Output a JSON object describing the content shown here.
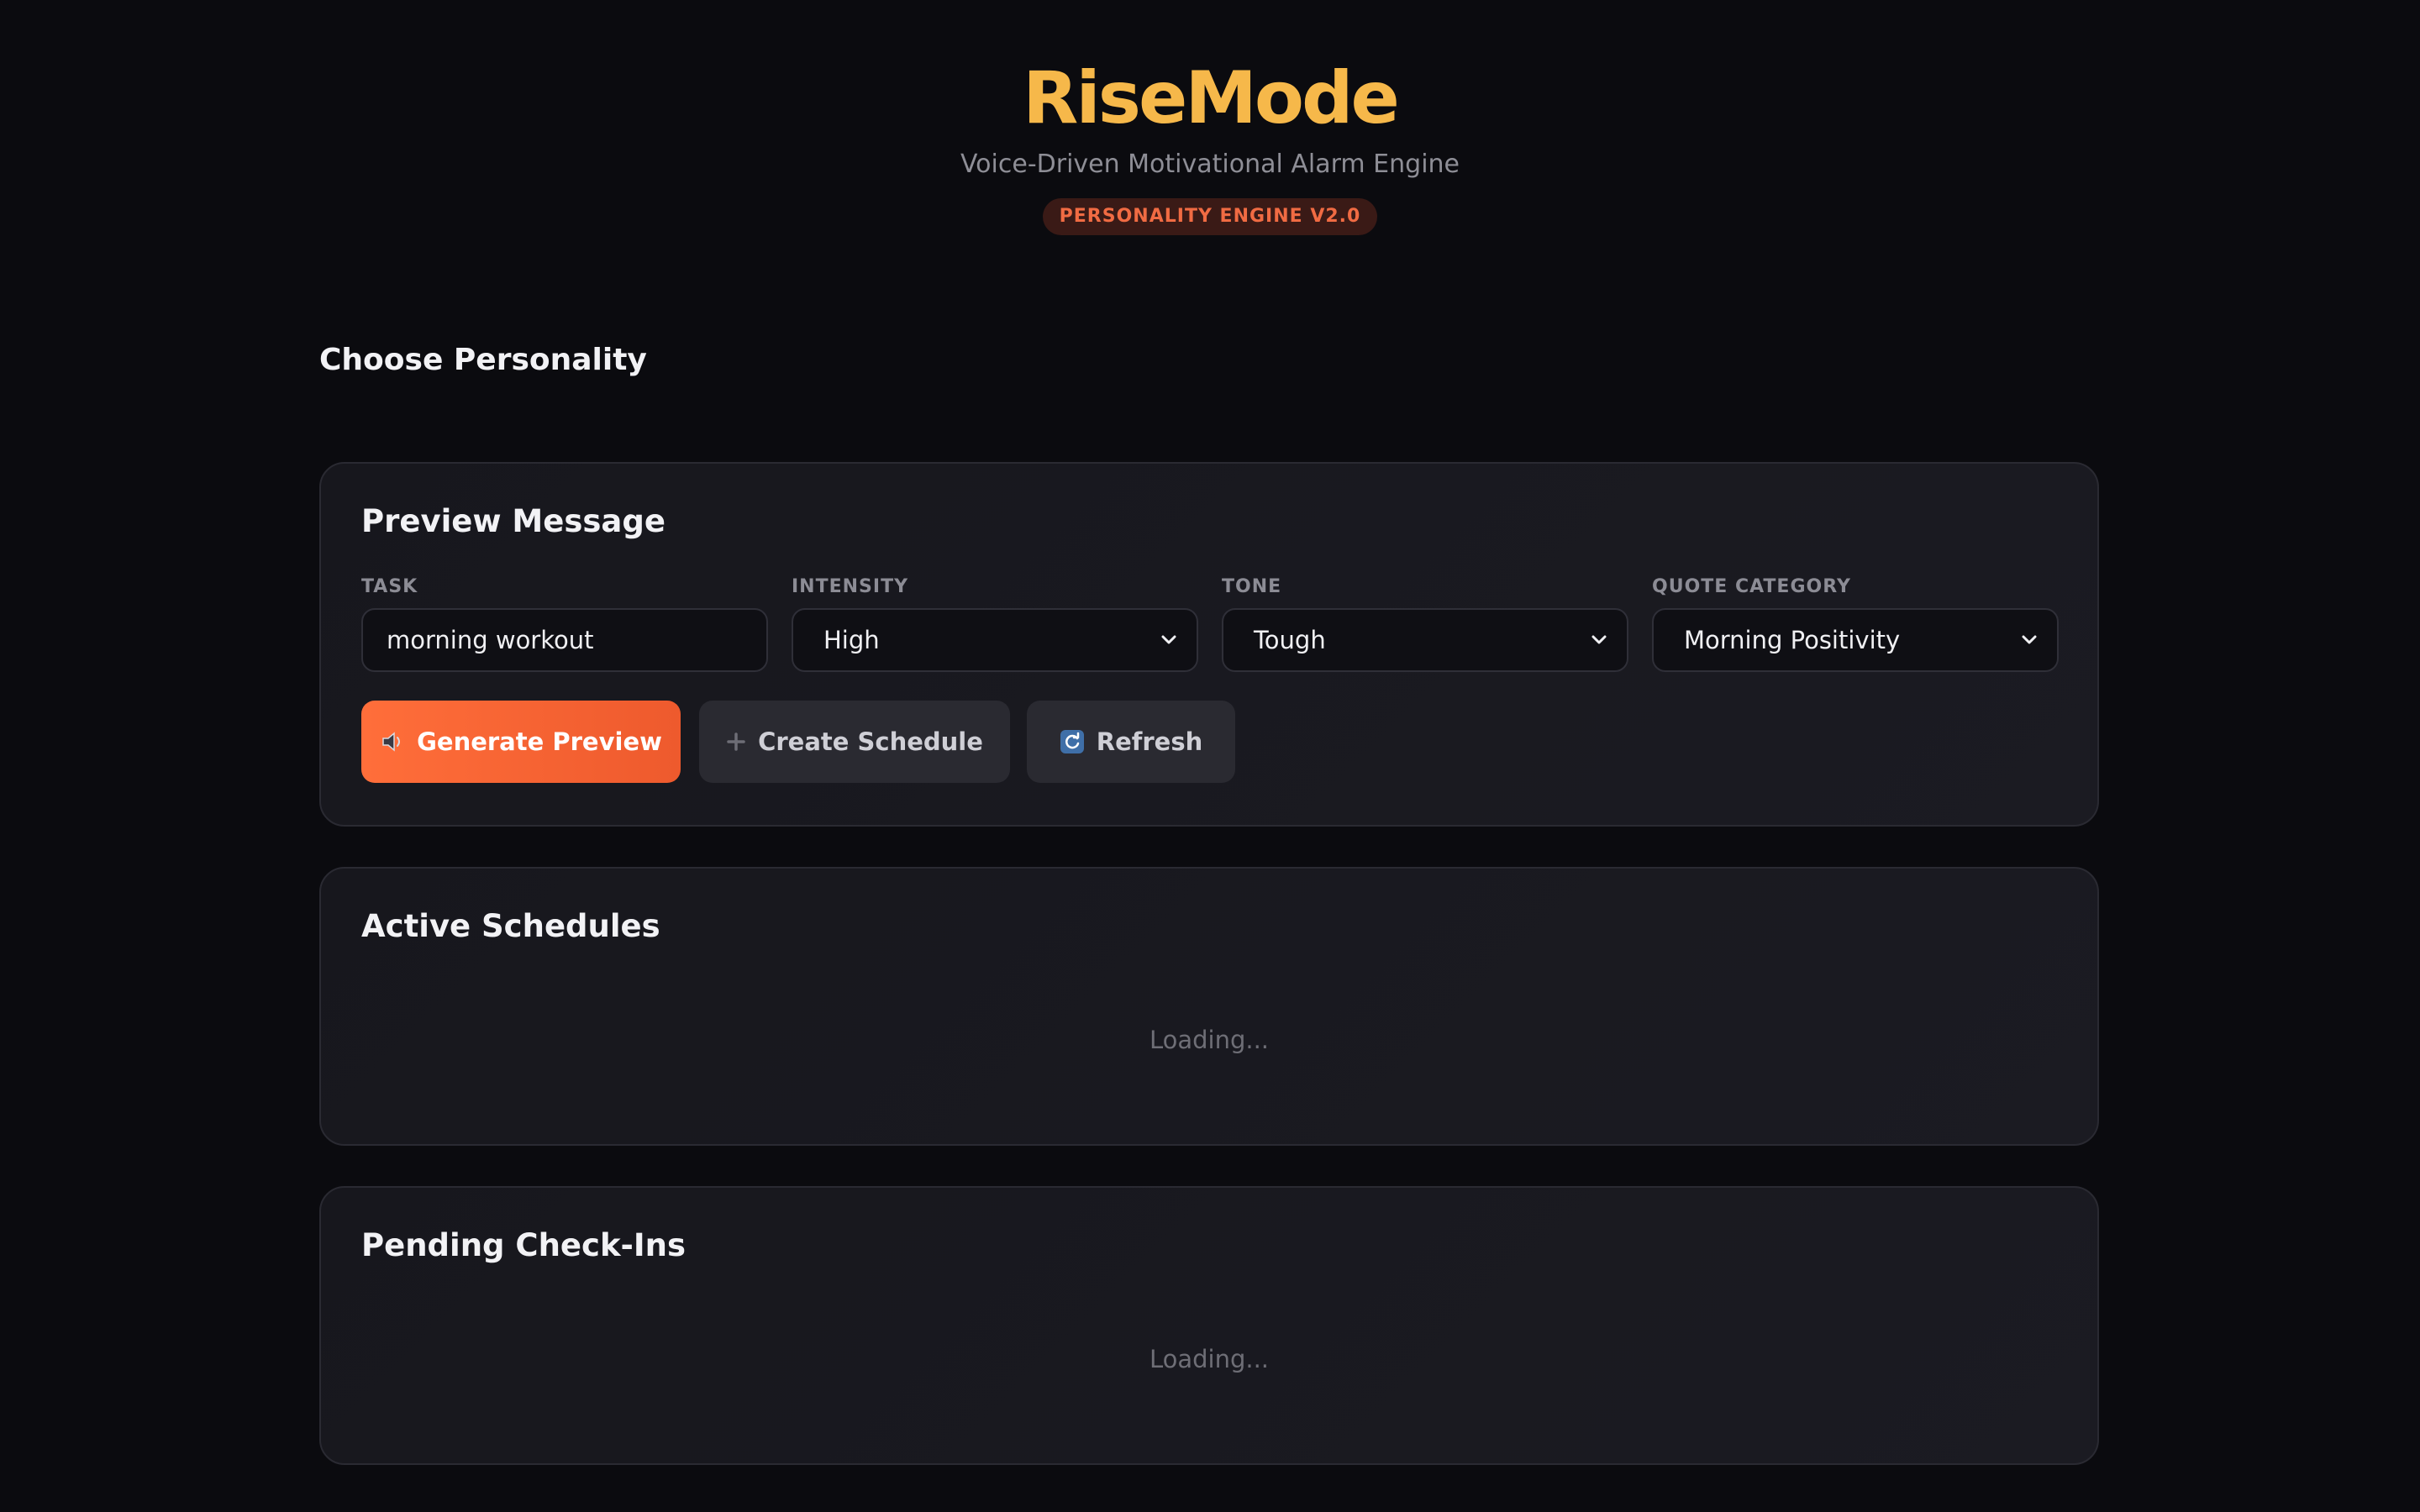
{
  "app": {
    "name": "RiseMode",
    "tagline": "Voice-Driven Motivational Alarm Engine",
    "badge": "PERSONALITY ENGINE V2.0"
  },
  "personality_section": {
    "title": "Choose Personality"
  },
  "preview_card": {
    "title": "Preview Message",
    "fields": {
      "task": {
        "label": "TASK",
        "value": "morning workout"
      },
      "intensity": {
        "label": "INTENSITY",
        "selected": "High"
      },
      "tone": {
        "label": "TONE",
        "selected": "Tough"
      },
      "quote_category": {
        "label": "QUOTE CATEGORY",
        "selected": "Morning Positivity"
      }
    },
    "buttons": {
      "generate": {
        "label": "Generate Preview",
        "icon": "speaker-icon"
      },
      "create": {
        "label": "Create Schedule",
        "icon": "plus-icon"
      },
      "refresh": {
        "label": "Refresh",
        "icon": "refresh-icon"
      }
    }
  },
  "schedules_card": {
    "title": "Active Schedules",
    "status": "Loading..."
  },
  "checkins_card": {
    "title": "Pending Check-Ins",
    "status": "Loading..."
  },
  "colors": {
    "background": "#0b0b0f",
    "brand": "#f6b84a",
    "accent": "#ff6e3a",
    "badge_text": "#f06b43",
    "card": "#18181e"
  }
}
